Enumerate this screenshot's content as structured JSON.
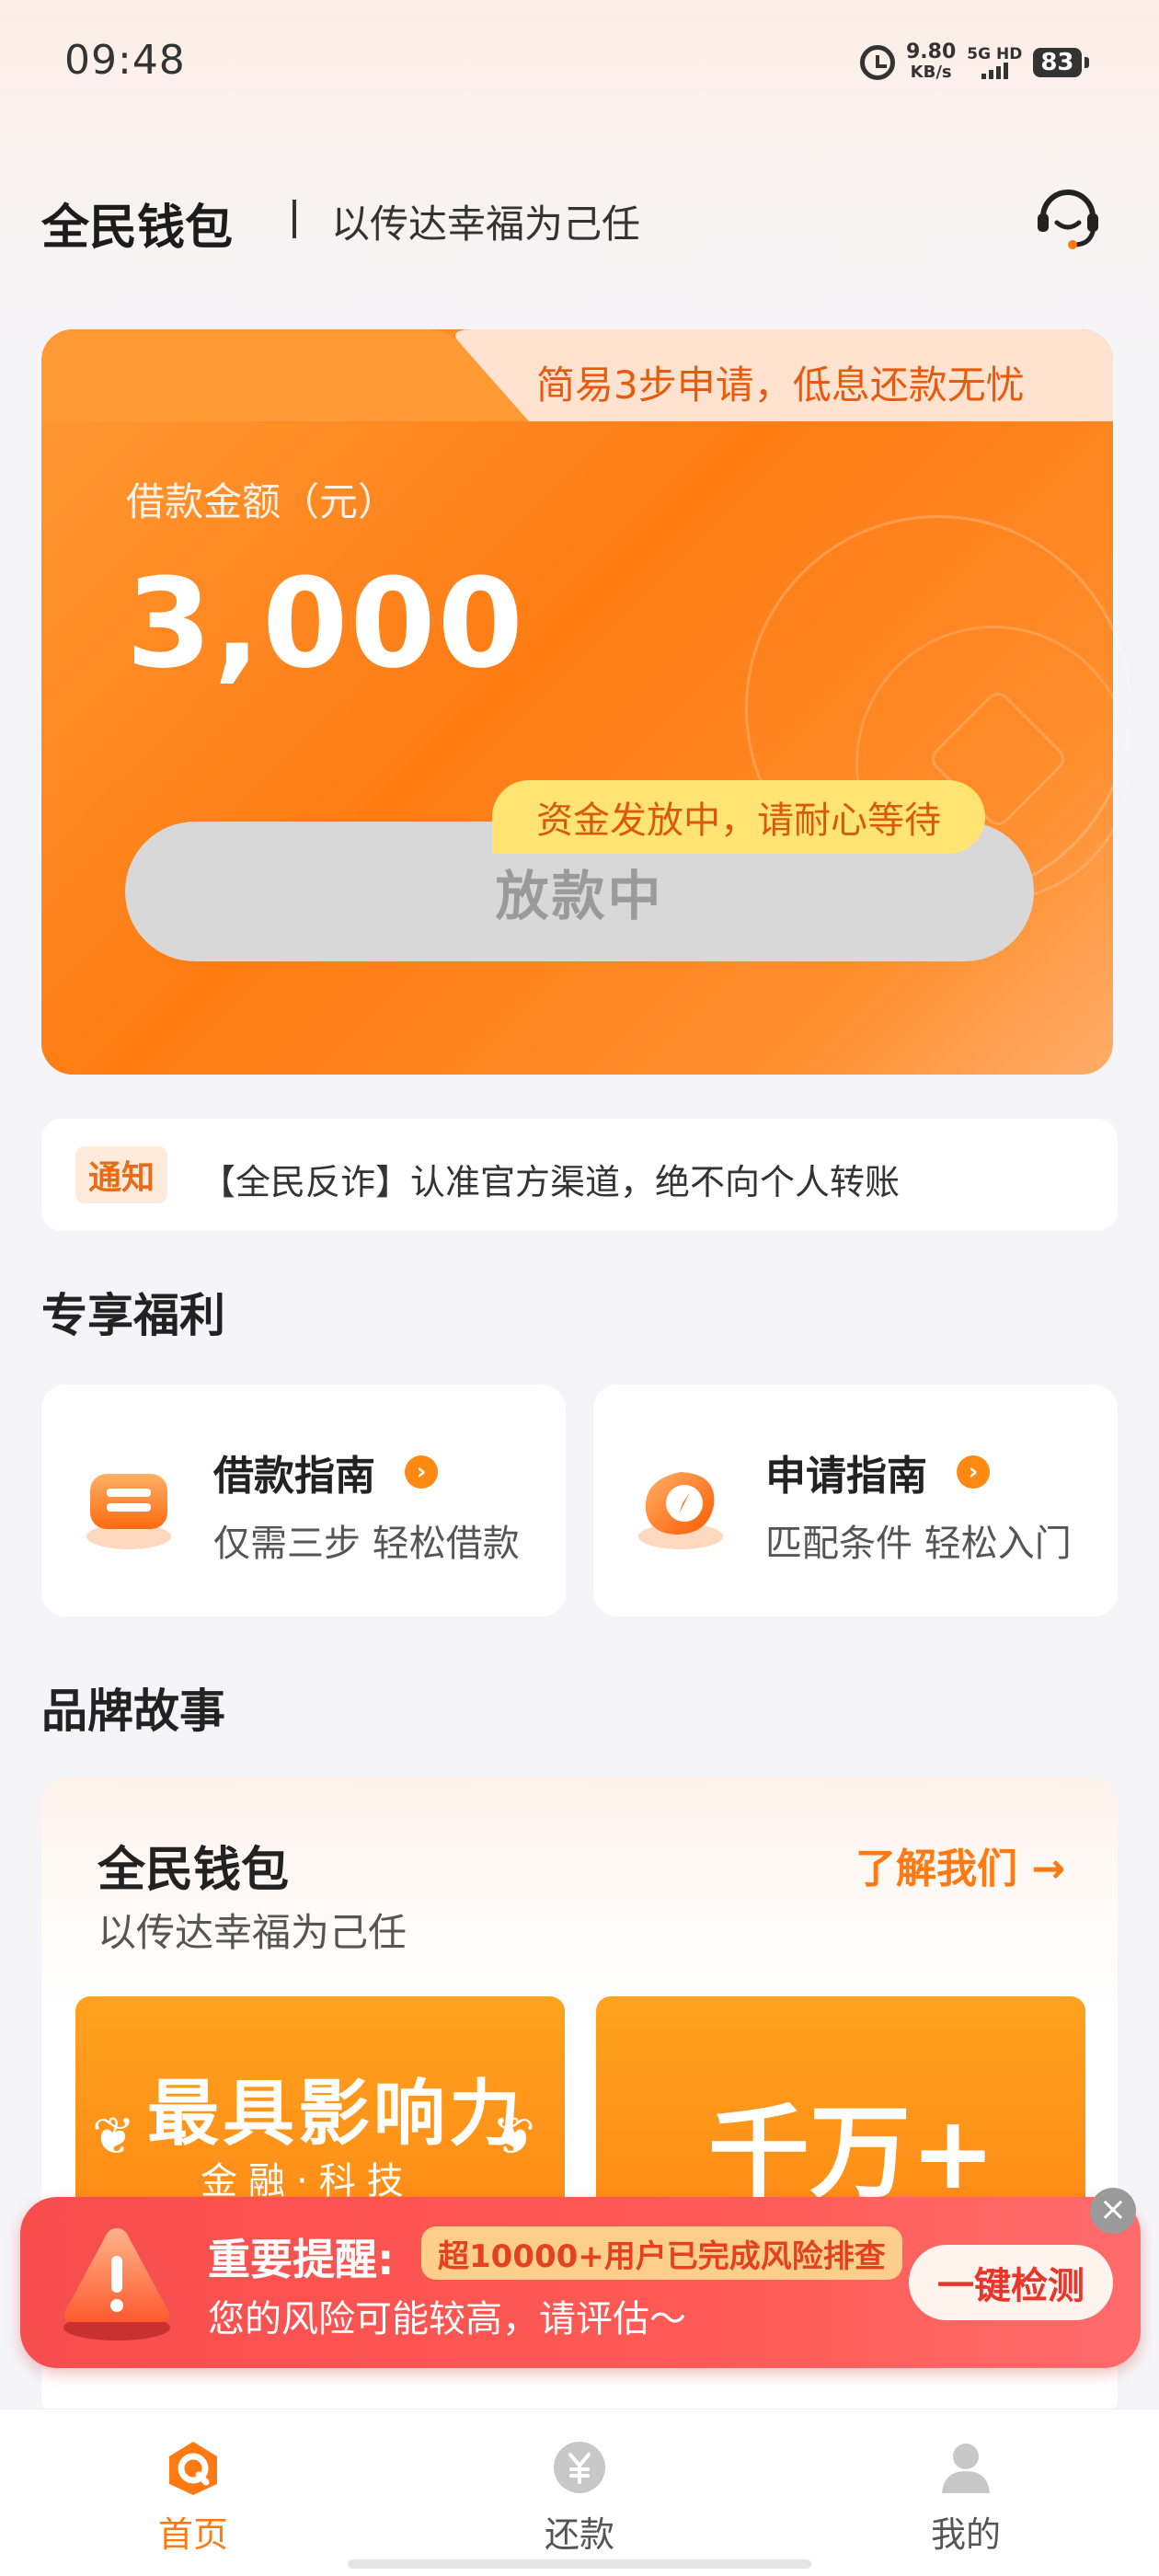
{
  "status_bar": {
    "time": "09:48",
    "net_speed": "9.80",
    "net_unit": "KB/s",
    "network": "5G HD",
    "battery": "83"
  },
  "header": {
    "brand": "全民钱包",
    "slogan": "以传达幸福为己任",
    "service_icon": "headset-icon"
  },
  "hero": {
    "tagline": "简易3步申请，低息还款无忧",
    "amount_label": "借款金额（元）",
    "amount": "3,000",
    "status_button": "放款中",
    "tooltip": "资金发放中，请耐心等待"
  },
  "notice": {
    "tag": "通知",
    "text": "【全民反诈】认准官方渠道，绝不向个人转账"
  },
  "benefits": {
    "title": "专享福利",
    "items": [
      {
        "title": "借款指南",
        "subtitle": "仅需三步 轻松借款",
        "icon": "guide-icon"
      },
      {
        "title": "申请指南",
        "subtitle": "匹配条件 轻松入门",
        "icon": "compass-icon"
      }
    ]
  },
  "brand_story": {
    "section_title": "品牌故事",
    "title": "全民钱包",
    "subtitle": "以传达幸福为己任",
    "link": "了解我们 →",
    "stats": [
      {
        "big": "最具影响力",
        "small": "金融·科技"
      },
      {
        "big": "千万+"
      }
    ]
  },
  "alert": {
    "title": "重要提醒:",
    "chip": "超10000+用户已完成风险排查",
    "desc": "您的风险可能较高，请评估～",
    "button": "一键检测",
    "close": "×"
  },
  "nav": {
    "items": [
      {
        "label": "首页",
        "icon": "home-icon",
        "active": true
      },
      {
        "label": "还款",
        "icon": "yuan-icon",
        "active": false
      },
      {
        "label": "我的",
        "icon": "user-icon",
        "active": false
      }
    ]
  },
  "colors": {
    "accent": "#ff7c14",
    "alert": "#f64d4d",
    "nav_active": "#ff7a12",
    "nav_inactive": "#555555"
  }
}
